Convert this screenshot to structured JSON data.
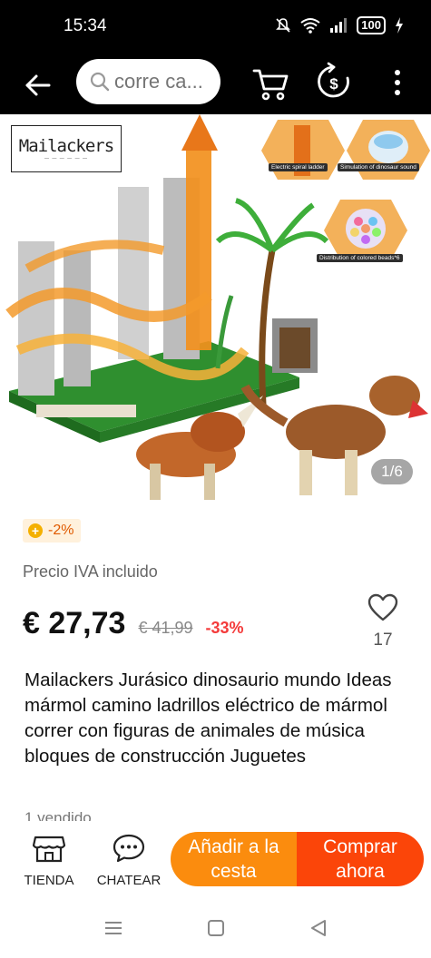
{
  "status_bar": {
    "time": "15:34",
    "battery": "100",
    "icons": [
      "mute-icon",
      "wifi-icon",
      "signal-icon",
      "battery-icon",
      "charging-icon"
    ]
  },
  "header": {
    "search_placeholder": "corre ca...",
    "icons": [
      "back-arrow-icon",
      "search-icon",
      "cart-icon",
      "coin-dollar-icon",
      "more-vertical-icon"
    ]
  },
  "gallery": {
    "brand": "Mailackers",
    "features": [
      {
        "label": "Electric spiral ladder"
      },
      {
        "label": "Simulation of dinosaur sound"
      },
      {
        "label": "Distribution of colored beads*6"
      }
    ],
    "counter": "1/6"
  },
  "coupon": {
    "text": "-2%"
  },
  "tax_note": "Precio IVA incluido",
  "pricing": {
    "price": "€ 27,73",
    "old_price": "€ 41,99",
    "discount": "-33%"
  },
  "wishlist": {
    "count": "17"
  },
  "product": {
    "title": "Mailackers Jurásico dinosaurio mundo Ideas mármol camino ladrillos eléctrico de mármol correr con figuras de animales de música bloques de construcción Juguetes",
    "sold": "1 vendido"
  },
  "bottom_bar": {
    "store_label": "TIENDA",
    "chat_label": "CHATEAR",
    "add_to_cart_label": "Añadir a la cesta",
    "buy_now_label": "Comprar ahora"
  },
  "colors": {
    "accent_orange": "#fb8c0e",
    "accent_red": "#fb4509",
    "discount_red": "#f43b3b"
  }
}
